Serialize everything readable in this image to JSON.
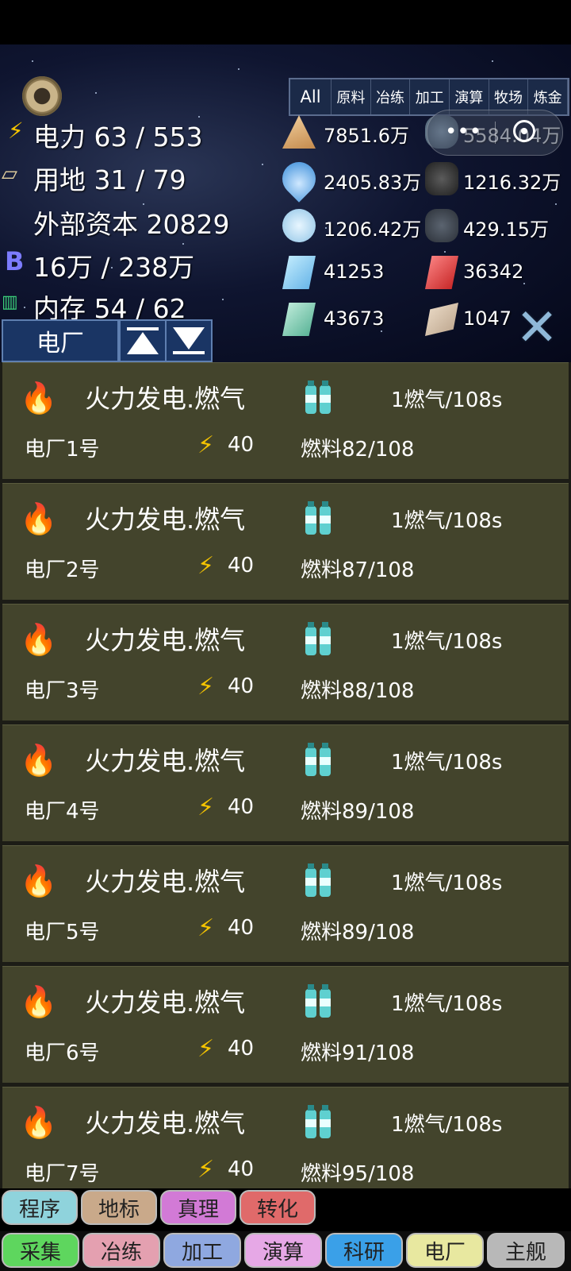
{
  "stats": {
    "power": "电力 63 / 553",
    "land": "用地 31 / 79",
    "capital": "外部资本 20829",
    "bits": "16万 / 238万",
    "memory": "内存 54 / 62"
  },
  "filter_tabs": [
    "All",
    "原料",
    "冶练",
    "加工",
    "演算",
    "牧场",
    "炼金"
  ],
  "resources": [
    {
      "value": "7851.6万",
      "icon": "sand-pile-icon"
    },
    {
      "value": "5584.04万",
      "icon": "ore-cluster-icon"
    },
    {
      "value": "2405.83万",
      "icon": "water-drop-icon"
    },
    {
      "value": "1216.32万",
      "icon": "coal-icon"
    },
    {
      "value": "1206.42万",
      "icon": "hydrogen-icon"
    },
    {
      "value": "429.15万",
      "icon": "stone-icon"
    },
    {
      "value": "41253",
      "icon": "glass-ingot-icon"
    },
    {
      "value": "36342",
      "icon": "copper-ingot-icon"
    },
    {
      "value": "43673",
      "icon": "iron-ingot-icon"
    },
    {
      "value": "1047",
      "icon": "brick-icon"
    }
  ],
  "category_button": "电厂",
  "plants": [
    {
      "name": "火力发电.燃气",
      "rate": "1燃气/108s",
      "plant": "电厂1号",
      "power": "40",
      "fuel": "燃料82/108"
    },
    {
      "name": "火力发电.燃气",
      "rate": "1燃气/108s",
      "plant": "电厂2号",
      "power": "40",
      "fuel": "燃料87/108"
    },
    {
      "name": "火力发电.燃气",
      "rate": "1燃气/108s",
      "plant": "电厂3号",
      "power": "40",
      "fuel": "燃料88/108"
    },
    {
      "name": "火力发电.燃气",
      "rate": "1燃气/108s",
      "plant": "电厂4号",
      "power": "40",
      "fuel": "燃料89/108"
    },
    {
      "name": "火力发电.燃气",
      "rate": "1燃气/108s",
      "plant": "电厂5号",
      "power": "40",
      "fuel": "燃料89/108"
    },
    {
      "name": "火力发电.燃气",
      "rate": "1燃气/108s",
      "plant": "电厂6号",
      "power": "40",
      "fuel": "燃料91/108"
    },
    {
      "name": "火力发电.燃气",
      "rate": "1燃气/108s",
      "plant": "电厂7号",
      "power": "40",
      "fuel": "燃料95/108"
    }
  ],
  "nav_row1": [
    {
      "label": "程序",
      "color": "#8fd3dc"
    },
    {
      "label": "地标",
      "color": "#c9a98a"
    },
    {
      "label": "真理",
      "color": "#d27ad6"
    },
    {
      "label": "转化",
      "color": "#e06a6a"
    }
  ],
  "nav_row2": [
    {
      "label": "采集",
      "color": "#5ed65e"
    },
    {
      "label": "冶练",
      "color": "#e4a0b0"
    },
    {
      "label": "加工",
      "color": "#8fa8e0"
    },
    {
      "label": "演算",
      "color": "#e6a8e6"
    },
    {
      "label": "科研",
      "color": "#3aa0e8"
    },
    {
      "label": "电厂",
      "color": "#e8e8a0"
    },
    {
      "label": "主舰",
      "color": "#b8b8b8"
    }
  ]
}
